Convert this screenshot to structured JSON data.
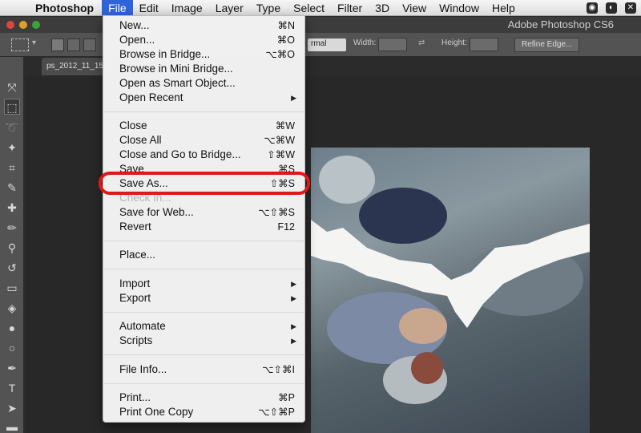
{
  "menubar": {
    "apple_icon": "apple-icon",
    "app": "Photoshop",
    "items": [
      "File",
      "Edit",
      "Image",
      "Layer",
      "Type",
      "Select",
      "Filter",
      "3D",
      "View",
      "Window",
      "Help"
    ],
    "active_item": "File"
  },
  "window": {
    "title": "Adobe Photoshop CS6"
  },
  "options_bar": {
    "style_value": "rmal",
    "width_label": "Width:",
    "height_label": "Height:",
    "refine_button": "Refine Edge..."
  },
  "document": {
    "tab_label": "ps_2012_11_15"
  },
  "file_menu": {
    "items": [
      {
        "label": "New...",
        "shortcut": "⌘N"
      },
      {
        "label": "Open...",
        "shortcut": "⌘O"
      },
      {
        "label": "Browse in Bridge...",
        "shortcut": "⌥⌘O"
      },
      {
        "label": "Browse in Mini Bridge...",
        "shortcut": ""
      },
      {
        "label": "Open as Smart Object...",
        "shortcut": ""
      },
      {
        "label": "Open Recent",
        "shortcut": "",
        "submenu": true
      },
      {
        "label": "Close",
        "shortcut": "⌘W"
      },
      {
        "label": "Close All",
        "shortcut": "⌥⌘W"
      },
      {
        "label": "Close and Go to Bridge...",
        "shortcut": "⇧⌘W"
      },
      {
        "label": "Save",
        "shortcut": "⌘S"
      },
      {
        "label": "Save As...",
        "shortcut": "⇧⌘S"
      },
      {
        "label": "Check In...",
        "shortcut": "",
        "disabled": true
      },
      {
        "label": "Save for Web...",
        "shortcut": "⌥⇧⌘S"
      },
      {
        "label": "Revert",
        "shortcut": "F12"
      },
      {
        "label": "Place...",
        "shortcut": ""
      },
      {
        "label": "Import",
        "shortcut": "",
        "submenu": true
      },
      {
        "label": "Export",
        "shortcut": "",
        "submenu": true
      },
      {
        "label": "Automate",
        "shortcut": "",
        "submenu": true
      },
      {
        "label": "Scripts",
        "shortcut": "",
        "submenu": true
      },
      {
        "label": "File Info...",
        "shortcut": "⌥⇧⌘I"
      },
      {
        "label": "Print...",
        "shortcut": "⌘P"
      },
      {
        "label": "Print One Copy",
        "shortcut": "⌥⇧⌘P"
      }
    ],
    "highlighted": "Save As...",
    "highlight_color": "#e01818"
  },
  "colors": {
    "menu_active": "#2f64d9",
    "ui_dark": "#535353"
  }
}
